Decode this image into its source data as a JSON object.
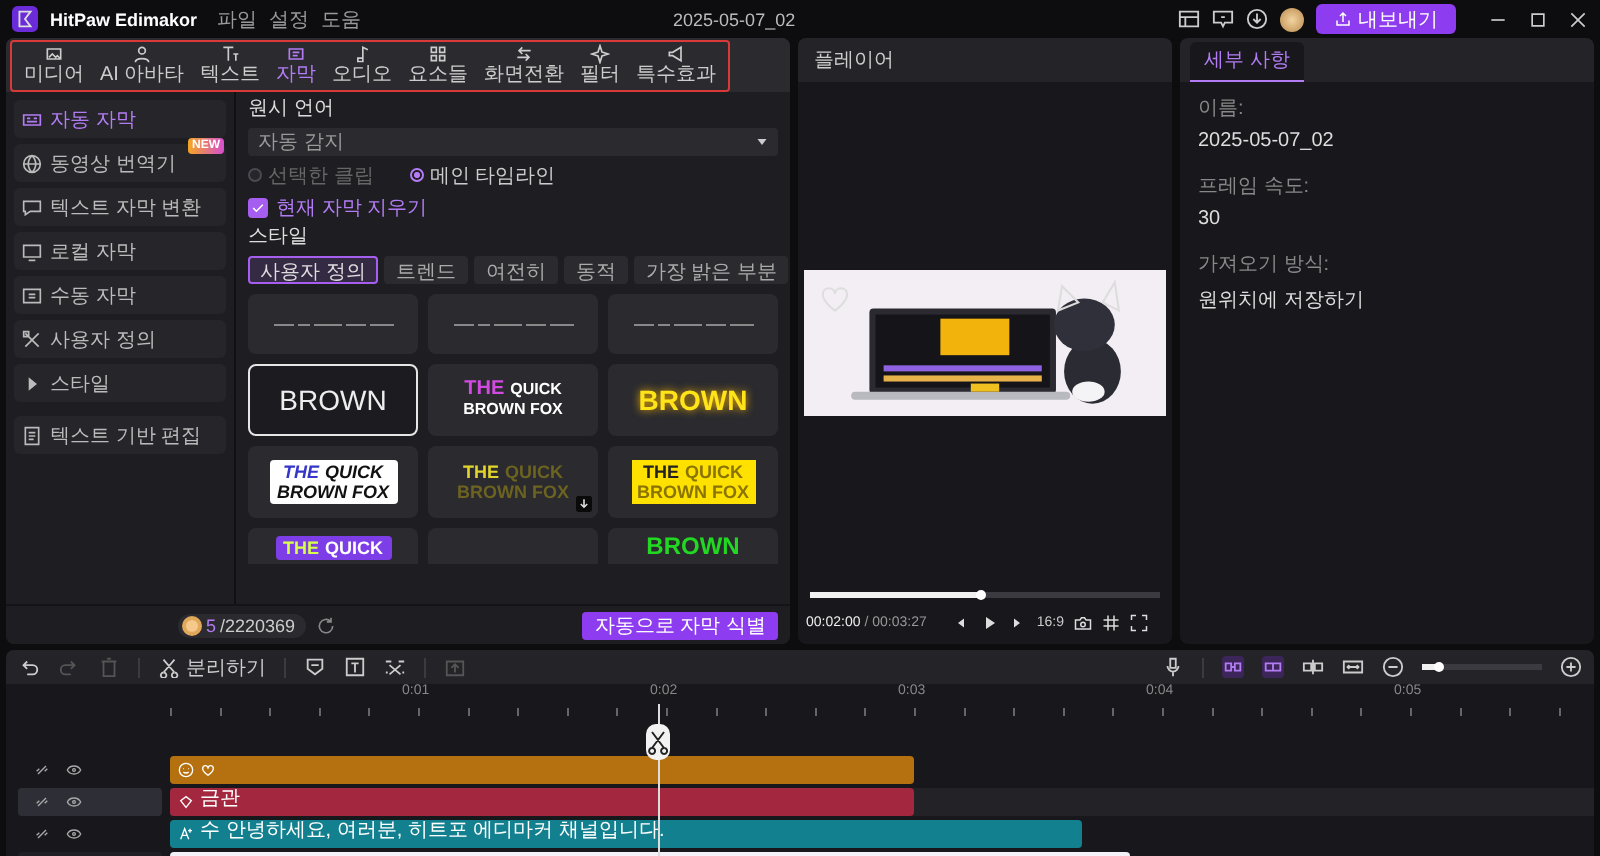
{
  "title_bar": {
    "app_name": "HitPaw Edimakor",
    "menus": [
      "파일",
      "설정",
      "도움"
    ],
    "project_name": "2025-05-07_02",
    "export_button": "내보내기"
  },
  "media_tabs": [
    {
      "label": "미디어",
      "selected": false
    },
    {
      "label": "AI 아바타",
      "selected": false
    },
    {
      "label": "텍스트",
      "selected": false
    },
    {
      "label": "자막",
      "selected": true
    },
    {
      "label": "오디오",
      "selected": false
    },
    {
      "label": "요소들",
      "selected": false
    },
    {
      "label": "화면전환",
      "selected": false
    },
    {
      "label": "필터",
      "selected": false
    },
    {
      "label": "특수효과",
      "selected": false
    }
  ],
  "sidebar": {
    "items": [
      {
        "label": "자동 자막",
        "selected": true
      },
      {
        "label": "동영상 번역기",
        "selected": false,
        "badge": "NEW"
      },
      {
        "label": "텍스트 자막 변환",
        "selected": false
      },
      {
        "label": "로컬 자막",
        "selected": false
      },
      {
        "label": "수동 자막",
        "selected": false
      },
      {
        "label": "사용자 정의",
        "selected": false
      },
      {
        "label": "스타일",
        "selected": false,
        "expanded": false
      },
      {
        "label": "텍스트 기반 편집",
        "selected": false
      }
    ]
  },
  "subtitle_settings": {
    "language_label": "원시 언어",
    "language_value": "자동 감지",
    "scope": [
      {
        "label": "선택한 클립",
        "selected": false,
        "disabled": true
      },
      {
        "label": "메인 타임라인",
        "selected": true,
        "disabled": false
      }
    ],
    "clear_current": {
      "label": "현재 자막 지우기",
      "checked": true
    }
  },
  "styles": {
    "title": "스타일",
    "filters": [
      {
        "label": "사용자 정의",
        "selected": true
      },
      {
        "label": "트렌드",
        "selected": false
      },
      {
        "label": "여전히",
        "selected": false
      },
      {
        "label": "동적",
        "selected": false
      },
      {
        "label": "가장 밝은 부분",
        "selected": false
      }
    ],
    "presets": [
      {
        "kind": "sample",
        "selected": false,
        "downloadable": false
      },
      {
        "kind": "sample",
        "selected": false,
        "downloadable": false
      },
      {
        "kind": "sample",
        "selected": false,
        "downloadable": false
      },
      {
        "kind": "outline",
        "lines": [
          [
            "BROWN"
          ]
        ],
        "selected": true,
        "downloadable": false
      },
      {
        "kind": "duo",
        "lines": [
          [
            "THE",
            "QUICK"
          ],
          [
            "BROWN FOX"
          ]
        ],
        "selected": false,
        "downloadable": false
      },
      {
        "kind": "glow",
        "lines": [
          [
            "BROWN"
          ]
        ],
        "selected": false,
        "downloadable": false
      },
      {
        "kind": "sticker",
        "lines": [
          [
            "THE",
            "QUICK"
          ],
          [
            "BROWN FOX"
          ]
        ],
        "selected": false,
        "downloadable": false
      },
      {
        "kind": "olive",
        "lines": [
          [
            "THE",
            "QUICK"
          ],
          [
            "BROWN FOX"
          ]
        ],
        "selected": false,
        "downloadable": true
      },
      {
        "kind": "yellow-box",
        "lines": [
          [
            "THE",
            "QUICK"
          ],
          [
            "BROWN FOX"
          ]
        ],
        "selected": false,
        "downloadable": false
      },
      {
        "kind": "purple-box",
        "lines": [
          [
            "THE",
            "QUICK"
          ]
        ],
        "selected": false,
        "downloadable": false
      },
      {
        "kind": "dark",
        "selected": false,
        "downloadable": false
      },
      {
        "kind": "green",
        "lines": [
          [
            "BROWN"
          ]
        ],
        "selected": false,
        "downloadable": false
      }
    ],
    "credits_used": "5",
    "credits_total": "/2220369",
    "identify_button": "자동으로 자막 식별"
  },
  "player": {
    "title": "플레이어",
    "progress": {
      "level": 0.49
    },
    "current_time": "00:02:00",
    "total_time": "/ 00:03:27",
    "aspect_ratio": "16:9"
  },
  "details": {
    "tab": {
      "label": "세부 사항",
      "selected": true
    },
    "fields": [
      {
        "label": "이름:",
        "value": "2025-05-07_02"
      },
      {
        "label": "프레임 속도:",
        "value": "30"
      },
      {
        "label": "가져오기 방식:",
        "value": "원위치에 저장하기"
      }
    ]
  },
  "timeline": {
    "split_button": "분리하기",
    "zoom": {
      "level": 0.15
    },
    "ticks": [
      "0:01",
      "0:02",
      "0:03",
      "0:04",
      "0:05"
    ],
    "tracks": [
      {
        "kind": "sticker",
        "color": "#b5700f",
        "selected": false
      },
      {
        "kind": "audio",
        "label": "금관",
        "color": "#a3283f",
        "selected": true
      },
      {
        "kind": "subtitle",
        "label": "수 안녕하세요, 여러분, 히트포 에디마커 채널입니다.",
        "color": "#13808f",
        "selected": false
      },
      {
        "kind": "video",
        "color": "#f3f1f7",
        "selected": false
      }
    ]
  }
}
